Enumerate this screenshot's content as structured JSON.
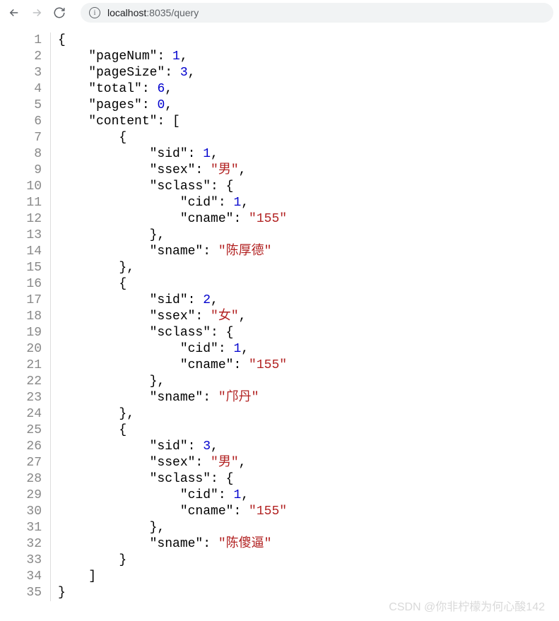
{
  "toolbar": {
    "url_host": "localhost",
    "url_port": ":8035",
    "url_path": "/query"
  },
  "response": {
    "pageNum": 1,
    "pageSize": 3,
    "total": 6,
    "pages": 0,
    "content": [
      {
        "sid": 1,
        "ssex": "男",
        "sclass": {
          "cid": 1,
          "cname": "155"
        },
        "sname": "陈厚德"
      },
      {
        "sid": 2,
        "ssex": "女",
        "sclass": {
          "cid": 1,
          "cname": "155"
        },
        "sname": "邝丹"
      },
      {
        "sid": 3,
        "ssex": "男",
        "sclass": {
          "cid": 1,
          "cname": "155"
        },
        "sname": "陈傻逼"
      }
    ]
  },
  "watermark": "CSDN @你非柠檬为何心酸142"
}
